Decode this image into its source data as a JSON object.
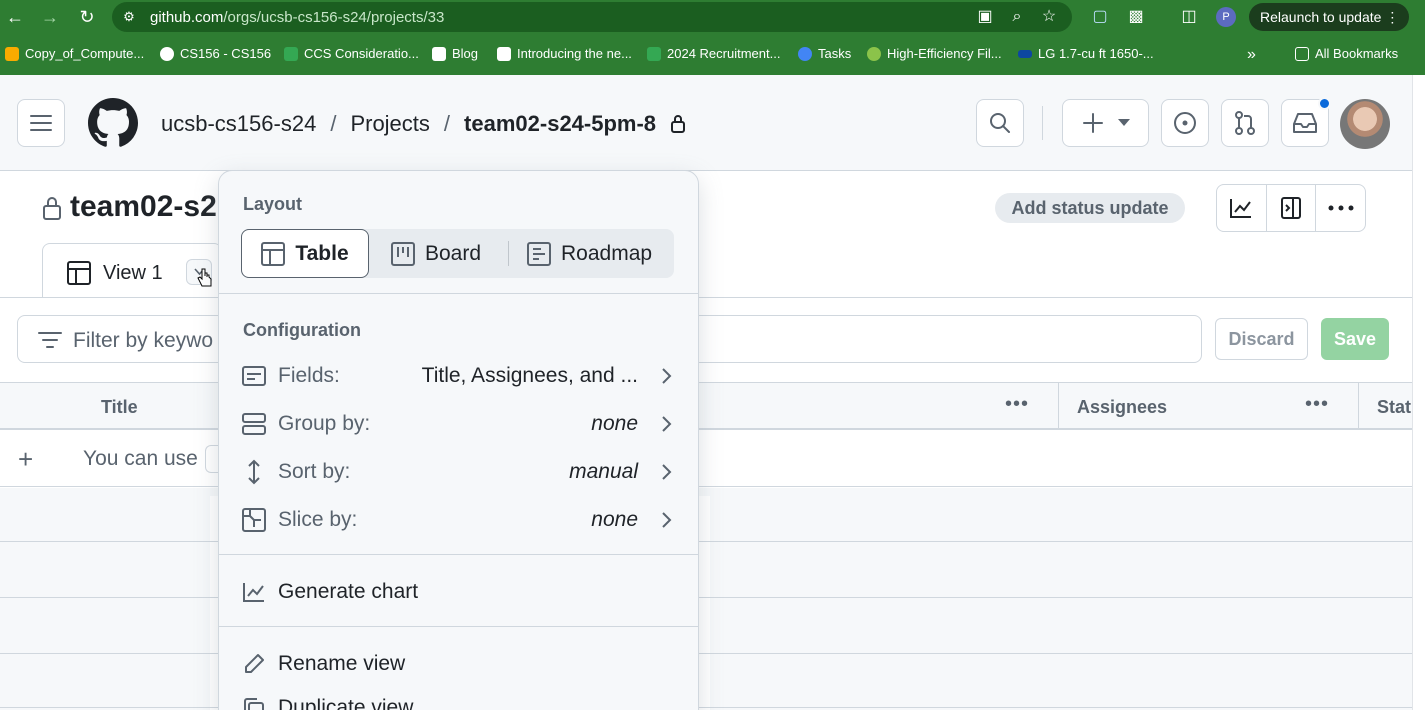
{
  "browser": {
    "url_host": "github.com",
    "url_path": "/orgs/ucsb-cs156-s24/projects/33",
    "relaunch_label": "Relaunch to update",
    "profile_initial": "P",
    "bookmarks": [
      {
        "label": "Copy_of_Compute...",
        "color": "#f9ab00"
      },
      {
        "label": "CS156 - CS156",
        "color": "#ffffff"
      },
      {
        "label": "CCS Consideratio...",
        "color": "#34a853"
      },
      {
        "label": "Blog",
        "color": "#ffffff"
      },
      {
        "label": "Introducing the ne...",
        "color": "#ffffff"
      },
      {
        "label": "2024 Recruitment...",
        "color": "#34a853"
      },
      {
        "label": "Tasks",
        "color": "#4285f4"
      },
      {
        "label": "High-Efficiency Fil...",
        "color": "#8bc34a"
      },
      {
        "label": "LG 1.7-cu ft 1650-...",
        "color": "#0d47a1"
      }
    ],
    "all_bookmarks_label": "All Bookmarks"
  },
  "header": {
    "org": "ucsb-cs156-s24",
    "section": "Projects",
    "project": "team02-s24-5pm-8",
    "sep": "/"
  },
  "project": {
    "title": "team02-s2",
    "status_button": "Add status update",
    "view_tab": "View 1",
    "filter_placeholder": "Filter by keywo",
    "discard_label": "Discard",
    "save_label": "Save"
  },
  "table": {
    "columns": [
      "Title",
      "Assignees",
      "Stat"
    ],
    "add_hint": "You can use"
  },
  "menu": {
    "layout_heading": "Layout",
    "layouts": [
      "Table",
      "Board",
      "Roadmap"
    ],
    "selected_layout": "Table",
    "config_heading": "Configuration",
    "config_items": [
      {
        "label": "Fields:",
        "value": "Title, Assignees, and ...",
        "icon": "fields-icon"
      },
      {
        "label": "Group by:",
        "value": "none",
        "icon": "group-by-icon"
      },
      {
        "label": "Sort by:",
        "value": "manual",
        "icon": "sort-icon"
      },
      {
        "label": "Slice by:",
        "value": "none",
        "icon": "slice-icon"
      }
    ],
    "generate_chart": "Generate chart",
    "rename_view": "Rename view",
    "duplicate_view": "Duplicate view"
  },
  "colors": {
    "chrome_green": "#2e7d32",
    "save_green": "#94d3a2",
    "notification_blue": "#0969da"
  }
}
